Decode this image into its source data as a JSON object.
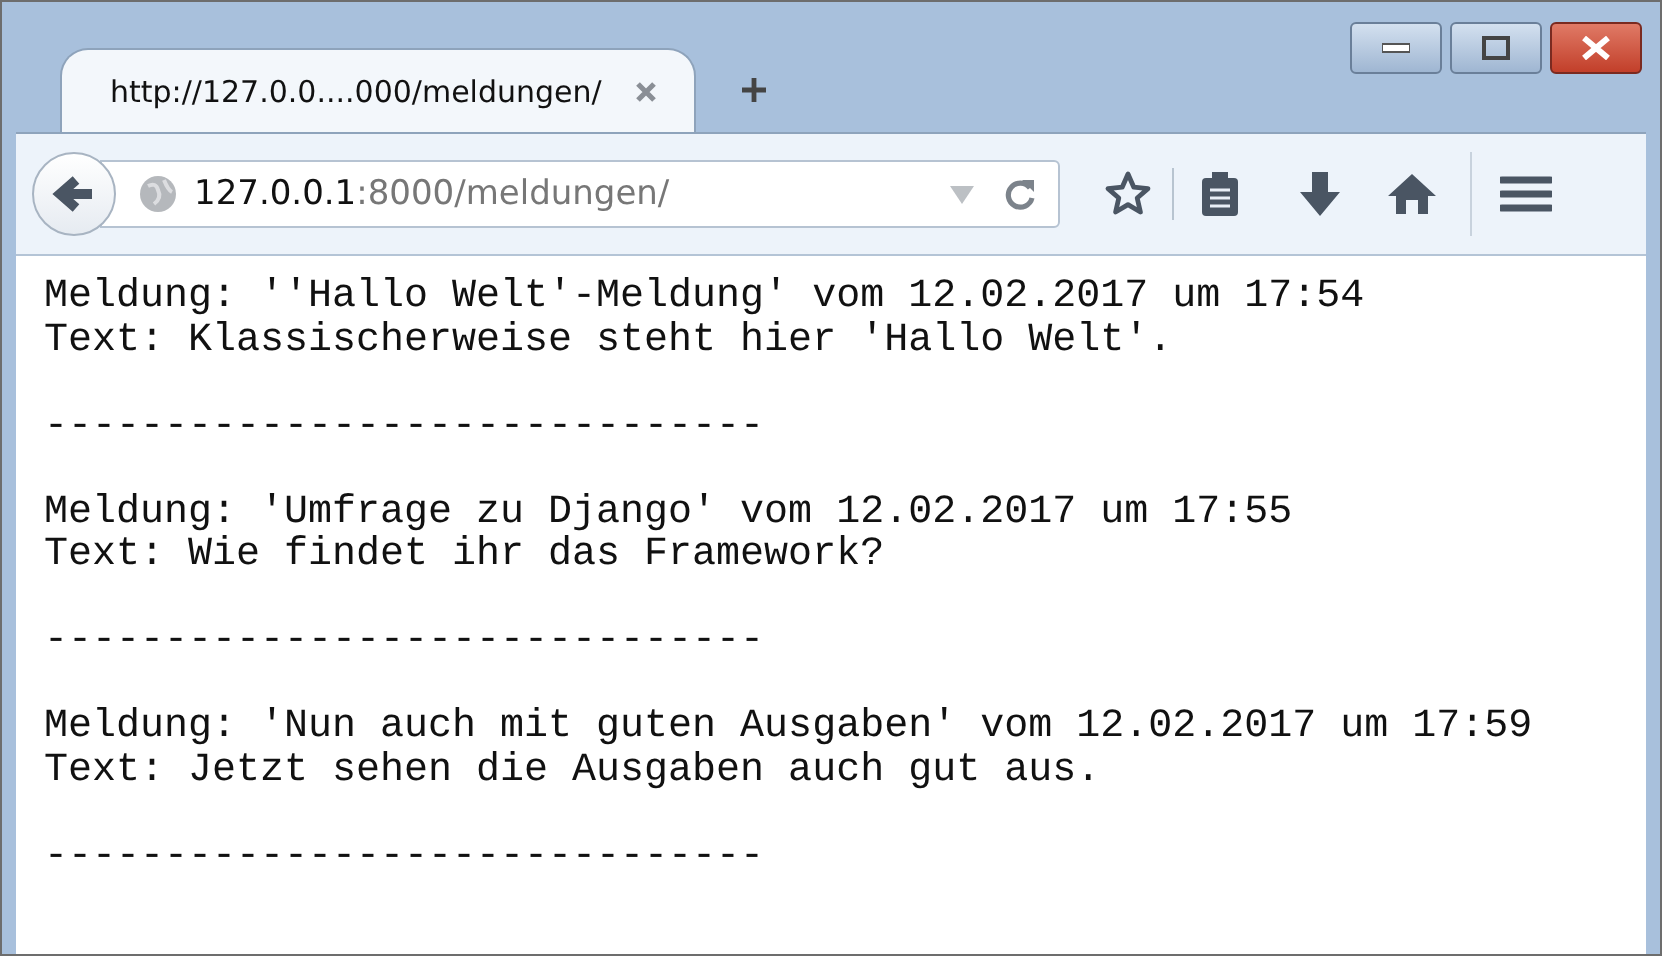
{
  "tab": {
    "title": "http://127.0.0....000/meldungen/",
    "selected": true
  },
  "address_bar": {
    "host": "127.0.0.1",
    "rest": ":8000/meldungen/"
  },
  "messages": [
    {
      "header": "Meldung: ''Hallo Welt'-Meldung' vom 12.02.2017 um 17:54",
      "text": "Text: Klassischerweise steht hier 'Hallo Welt'.",
      "separator": "------------------------------"
    },
    {
      "header": "Meldung: 'Umfrage zu Django' vom 12.02.2017 um 17:55",
      "text": "Text: Wie findet ihr das Framework?",
      "separator": "------------------------------"
    },
    {
      "header": "Meldung: 'Nun auch mit guten Ausgaben' vom 12.02.2017 um 17:59",
      "text": "Text: Jetzt sehen die Ausgaben auch gut aus.",
      "separator": "------------------------------"
    }
  ]
}
